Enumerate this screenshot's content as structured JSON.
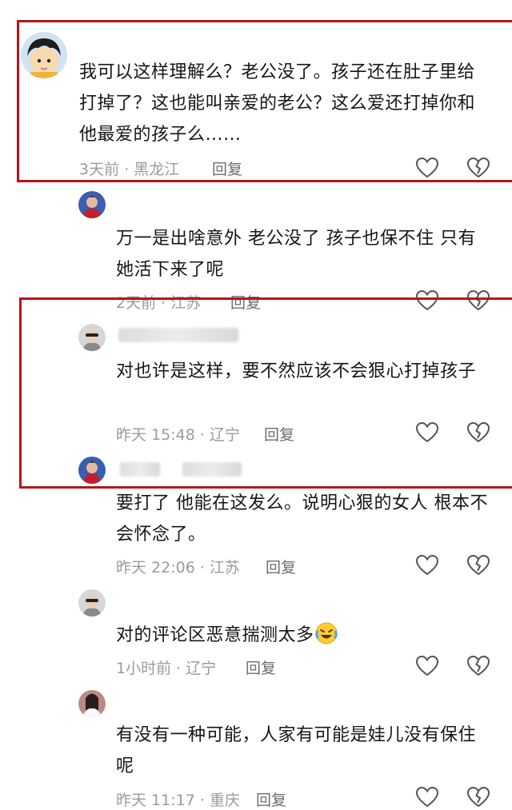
{
  "comments": [
    {
      "text": "我可以这样理解么？老公没了。孩子还在肚子里给打掉了？这也能叫亲爱的老公？这么爱还打掉你和他最爱的孩子么……",
      "time_location": "3天前 · 黑龙江",
      "reply_label": "回复"
    },
    {
      "text": "万一是出啥意外 老公没了 孩子也保不住 只有她活下来了呢",
      "time_location": "2天前 · 江苏",
      "reply_label": "回复"
    },
    {
      "text": "对也许是这样，要不然应该不会狠心打掉孩子",
      "time_location": "昨天 15:48 · 辽宁",
      "reply_label": "回复"
    },
    {
      "text": "要打了 他能在这发么。说明心狠的女人 根本不会怀念了。",
      "time_location": "昨天 22:06 · 江苏",
      "reply_label": "回复"
    },
    {
      "text": "对的评论区恶意揣测太多",
      "emoji": "laughing-crying-emoji",
      "time_location": "1小时前 · 辽宁",
      "reply_label": "回复"
    },
    {
      "text": "有没有一种可能，人家有可能是娃儿没有保住呢",
      "time_location": "昨天 11:17 · 重庆",
      "reply_label": "回复"
    }
  ],
  "icons": {
    "like": "heart-outline-icon",
    "dislike": "broken-heart-icon"
  },
  "colors": {
    "highlight_box": "#b8141c",
    "meta_text": "#9b9b9b"
  }
}
